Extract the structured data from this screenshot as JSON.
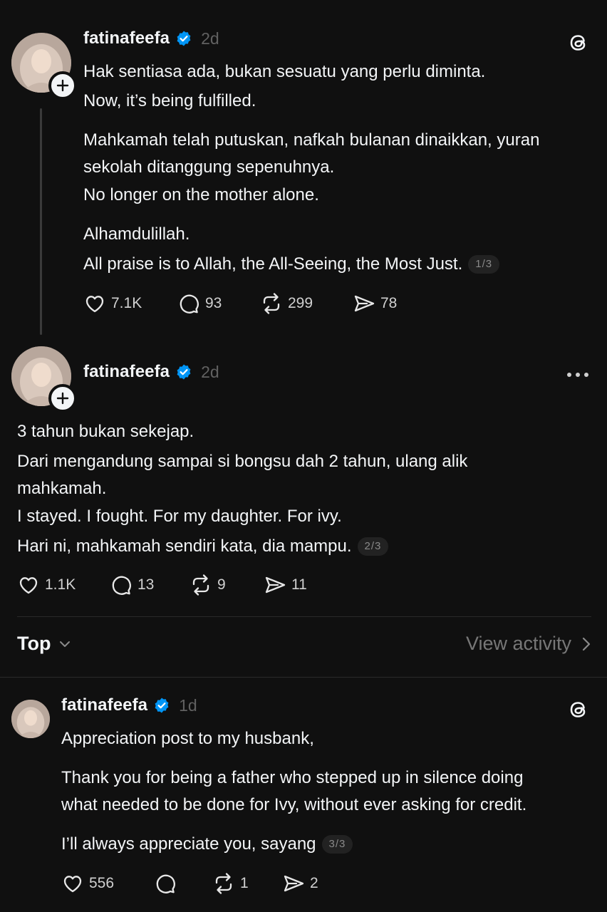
{
  "post1": {
    "username": "fatinafeefa",
    "time": "2d",
    "lines": [
      "Hak sentiasa ada, bukan sesuatu yang perlu diminta.",
      "Now, it’s being fulfilled.",
      "Mahkamah telah putuskan, nafkah bulanan dinaikkan, yuran",
      "sekolah ditanggung sepenuhnya.",
      "No longer on the mother alone.",
      "Alhamdulillah.",
      "All praise is to Allah, the All-Seeing, the Most Just."
    ],
    "pager": "1/3",
    "likes": "7.1K",
    "replies": "93",
    "reposts": "299",
    "shares": "78"
  },
  "post2": {
    "username": "fatinafeefa",
    "time": "2d",
    "lines": [
      "3 tahun bukan sekejap.",
      "Dari mengandung sampai si bongsu dah 2 tahun, ulang alik",
      "mahkamah.",
      "I stayed. I fought. For my daughter. For ivy.",
      "Hari ni, mahkamah sendiri kata, dia mampu."
    ],
    "pager": "2/3",
    "likes": "1.1K",
    "replies": "13",
    "reposts": "9",
    "shares": "11"
  },
  "sort": {
    "label": "Top",
    "view_activity": "View activity"
  },
  "post3": {
    "username": "fatinafeefa",
    "time": "1d",
    "lines": [
      "Appreciation post to my husbank,",
      "Thank you for being a father who stepped up in silence doing",
      "what needed to be done for Ivy, without ever asking for credit.",
      "I’ll always appreciate you, sayang"
    ],
    "pager": "3/3",
    "likes": "556",
    "replies": "",
    "reposts": "1",
    "shares": "2"
  },
  "icons": {
    "verified": "verified-badge-icon",
    "threads": "threads-logo-icon",
    "like": "heart-icon",
    "reply": "comment-icon",
    "repost": "repost-icon",
    "share": "share-icon",
    "more": "more-icon",
    "chevron_down": "chevron-down-icon",
    "chevron_right": "chevron-right-icon",
    "plus": "plus-icon"
  },
  "colors": {
    "background": "#101010",
    "text": "#f3f5f7",
    "muted": "#616161",
    "verified": "#0095f6"
  }
}
